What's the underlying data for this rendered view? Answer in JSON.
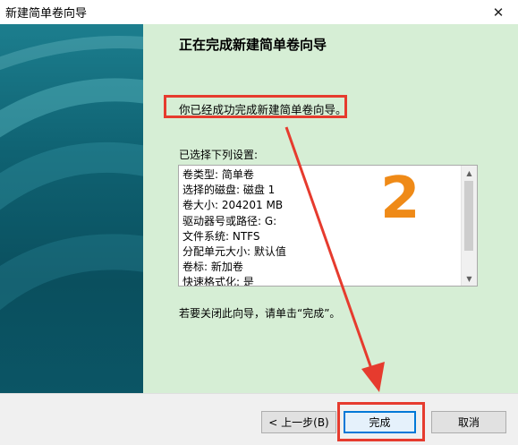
{
  "window": {
    "title": "新建简单卷向导",
    "close_glyph": "✕"
  },
  "content": {
    "heading": "正在完成新建简单卷向导",
    "done_message": "你已经成功完成新建简单卷向导。",
    "list_label": "已选择下列设置:",
    "summary_lines": [
      "卷类型: 简单卷",
      "选择的磁盘: 磁盘 1",
      "卷大小: 204201 MB",
      "驱动器号或路径: G:",
      "文件系统: NTFS",
      "分配单元大小: 默认值",
      "卷标: 新加卷",
      "快速格式化: 是"
    ],
    "close_hint": "若要关闭此向导，请单击“完成”。"
  },
  "buttons": {
    "back": "< 上一步(B)",
    "finish": "完成",
    "cancel": "取消"
  },
  "annotation": {
    "step_number": "2",
    "box_color": "#e63b2e",
    "number_color": "#ef8a17"
  },
  "icons": {
    "scroll_up": "▲",
    "scroll_down": "▼"
  }
}
